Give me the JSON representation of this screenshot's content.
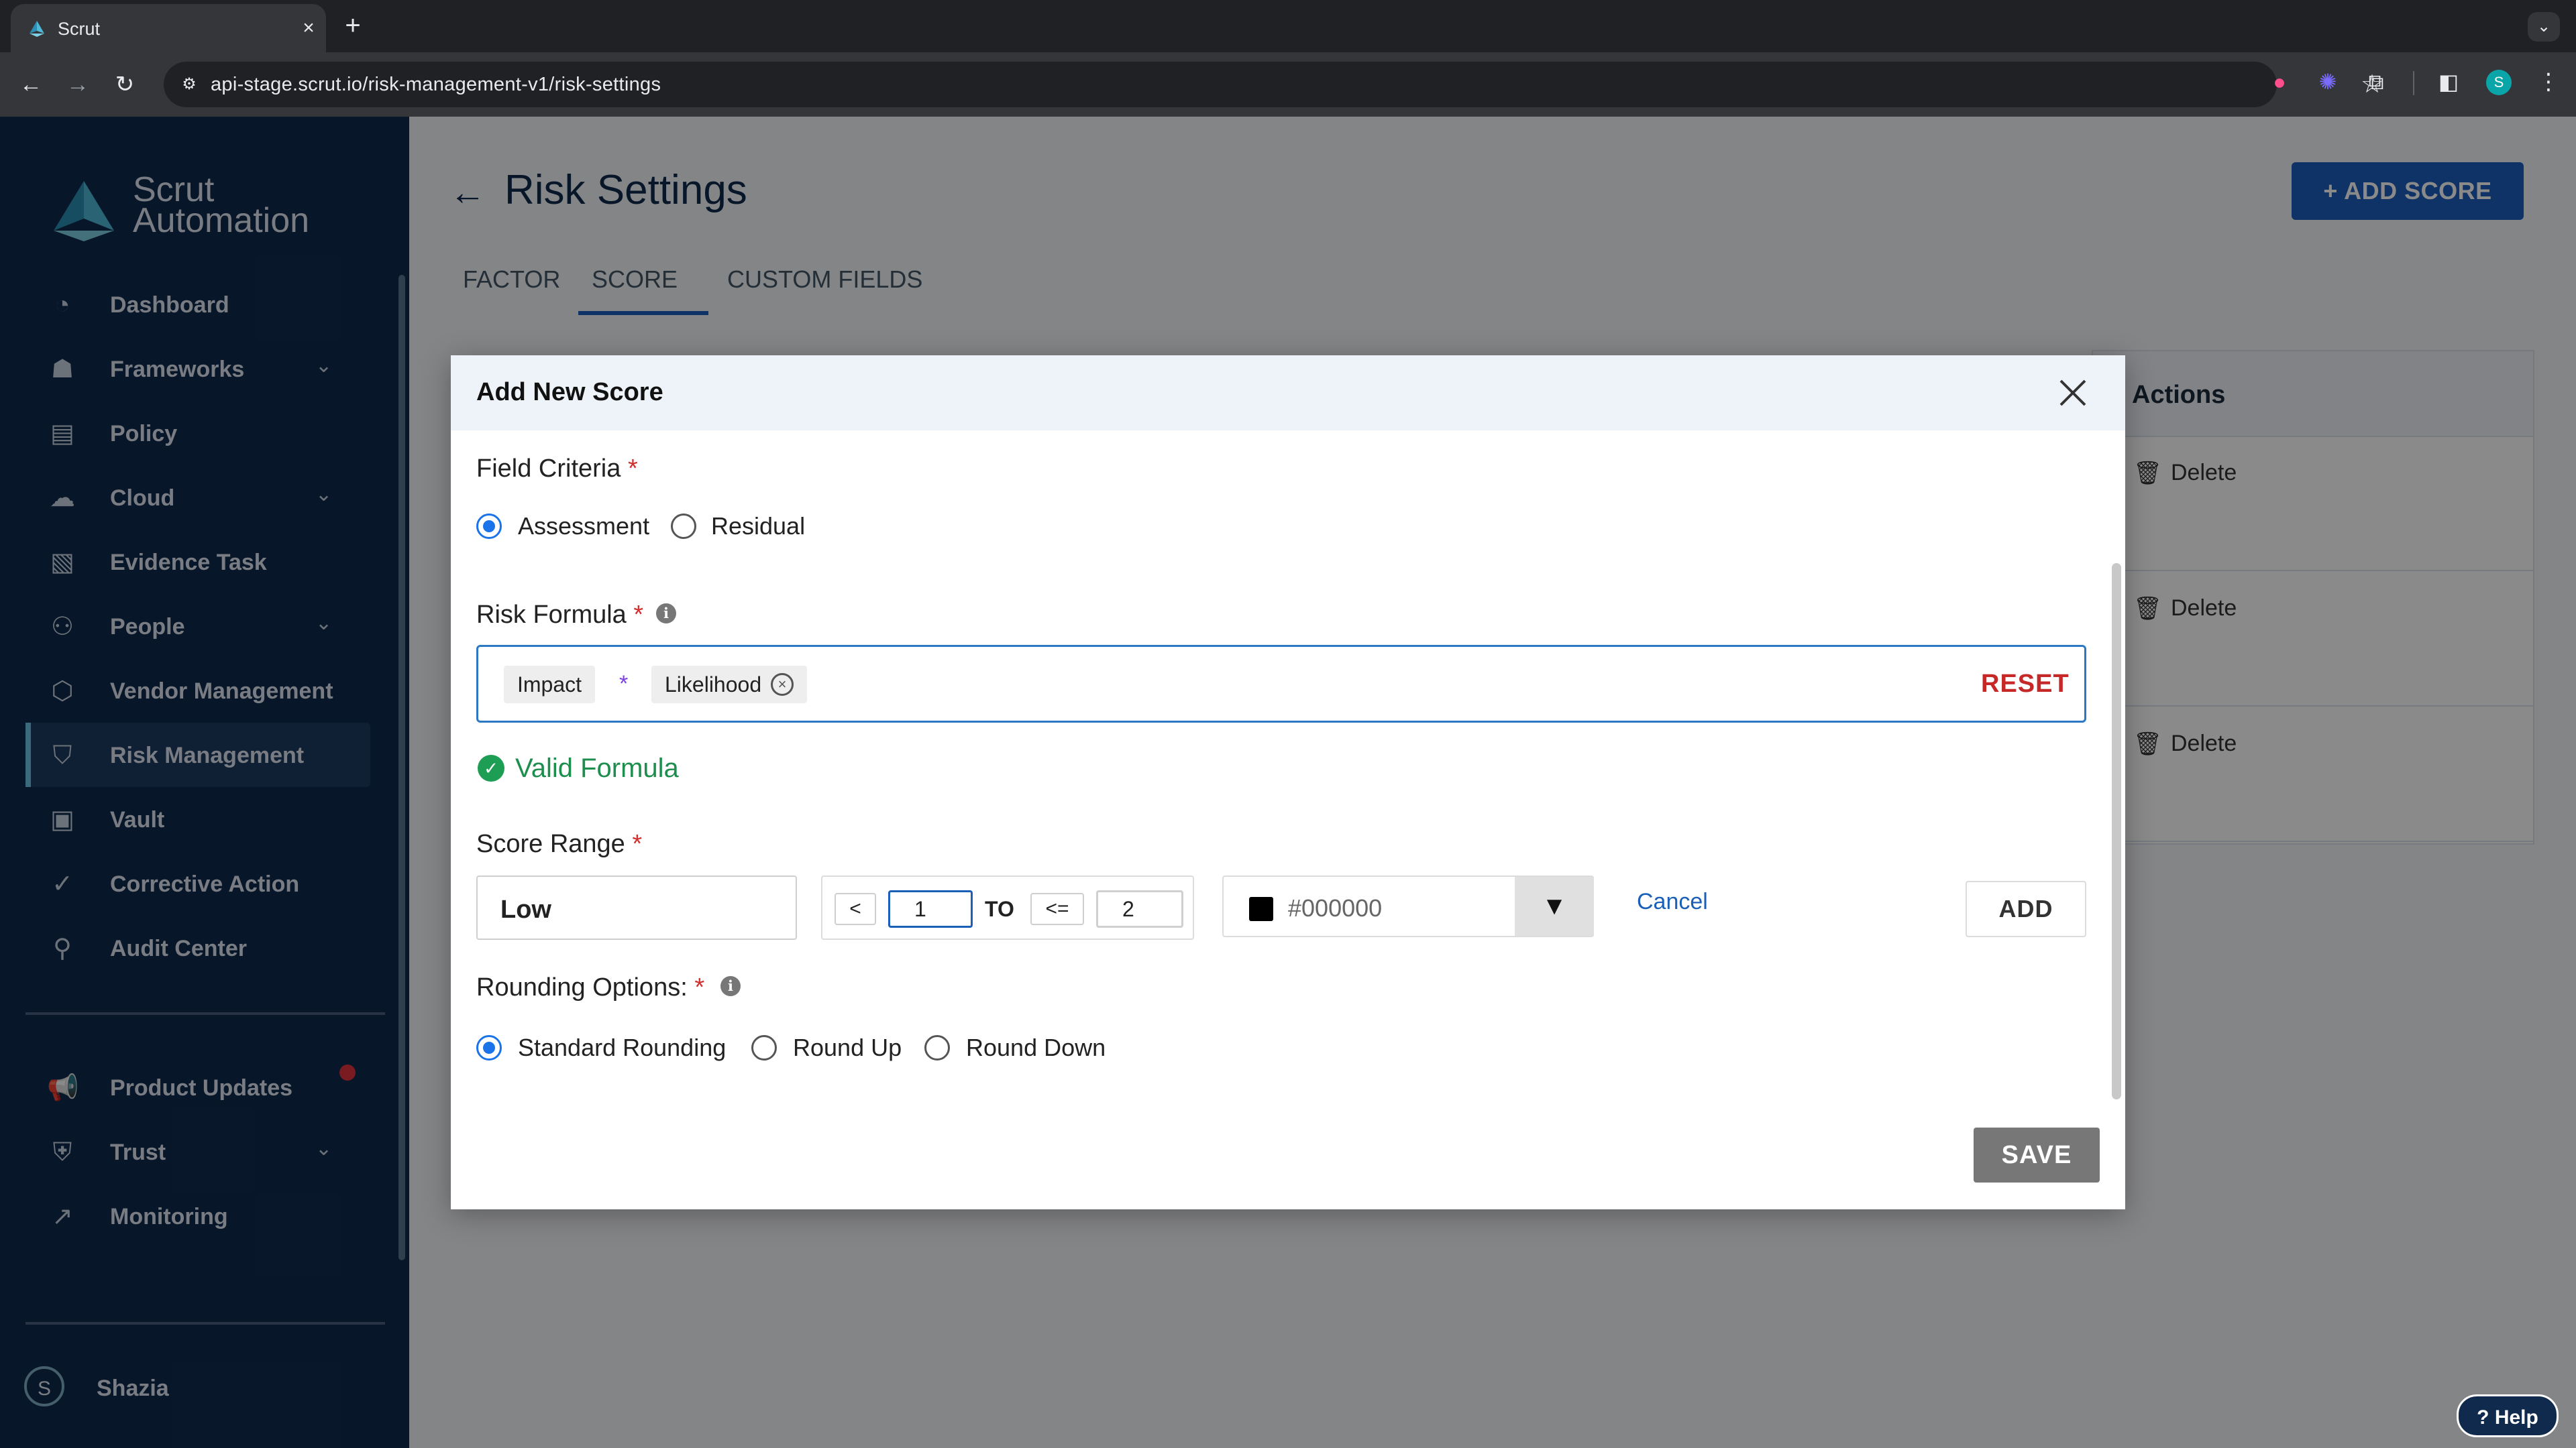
{
  "browser": {
    "tab_title": "Scrut",
    "close_tab_icon": "×",
    "new_tab_icon": "+",
    "url": "api-stage.scrut.io/risk-management-v1/risk-settings"
  },
  "sidebar": {
    "logo_line1": "Scrut",
    "logo_line2": "Automation",
    "items": [
      {
        "label": "Dashboard",
        "icon": "dashboard-icon",
        "has_chevron": false
      },
      {
        "label": "Frameworks",
        "icon": "frameworks-icon",
        "has_chevron": true
      },
      {
        "label": "Policy",
        "icon": "policy-icon",
        "has_chevron": false
      },
      {
        "label": "Cloud",
        "icon": "cloud-icon",
        "has_chevron": true
      },
      {
        "label": "Evidence Task",
        "icon": "evidence-icon",
        "has_chevron": false
      },
      {
        "label": "People",
        "icon": "people-icon",
        "has_chevron": true
      },
      {
        "label": "Vendor Management",
        "icon": "vendor-icon",
        "has_chevron": false
      },
      {
        "label": "Risk Management",
        "icon": "shield-icon",
        "has_chevron": false,
        "active": true
      },
      {
        "label": "Vault",
        "icon": "vault-icon",
        "has_chevron": false
      },
      {
        "label": "Corrective Action",
        "icon": "check-icon",
        "has_chevron": false
      },
      {
        "label": "Audit Center",
        "icon": "audit-icon",
        "has_chevron": false
      }
    ],
    "bottom_items": [
      {
        "label": "Product Updates",
        "icon": "megaphone-icon",
        "has_chevron": false
      },
      {
        "label": "Trust",
        "icon": "trust-icon",
        "has_chevron": true
      },
      {
        "label": "Monitoring",
        "icon": "chart-icon",
        "has_chevron": false
      }
    ],
    "user_initial": "S",
    "user_name": "Shazia"
  },
  "page": {
    "title": "Risk Settings",
    "add_score_label": "+ ADD SCORE",
    "tabs": [
      "FACTOR",
      "SCORE",
      "CUSTOM FIELDS"
    ],
    "active_tab": "SCORE",
    "table_header_actions": "Actions",
    "row_action": "Delete"
  },
  "modal": {
    "title": "Add New Score",
    "field_criteria_label": "Field Criteria",
    "field_criteria_options": [
      "Assessment",
      "Residual"
    ],
    "field_criteria_selected": "Assessment",
    "risk_formula_label": "Risk Formula",
    "formula_tokens": [
      "Impact",
      "*",
      "Likelihood"
    ],
    "reset_label": "RESET",
    "valid_formula_text": "Valid Formula",
    "score_range_label": "Score Range",
    "score_name_value": "Low",
    "lower_operator": "<",
    "lower_value": "1",
    "to_label": "TO",
    "upper_operator": "<=",
    "upper_value": "2",
    "color_value": "#000000",
    "cancel_label": "Cancel",
    "add_label": "ADD",
    "rounding_label": "Rounding Options:",
    "rounding_options": [
      "Standard Rounding",
      "Round Up",
      "Round Down"
    ],
    "rounding_selected": "Standard Rounding",
    "save_label": "SAVE",
    "required_mark": "*",
    "info_glyph": "i"
  },
  "help_label": "Help",
  "colors": {
    "sidebar_bg": "#0f2a4d",
    "primary": "#1d5fbd",
    "radio_selected": "#1a73e8",
    "reset_red": "#c62828",
    "valid_green": "#1e8e4e"
  }
}
